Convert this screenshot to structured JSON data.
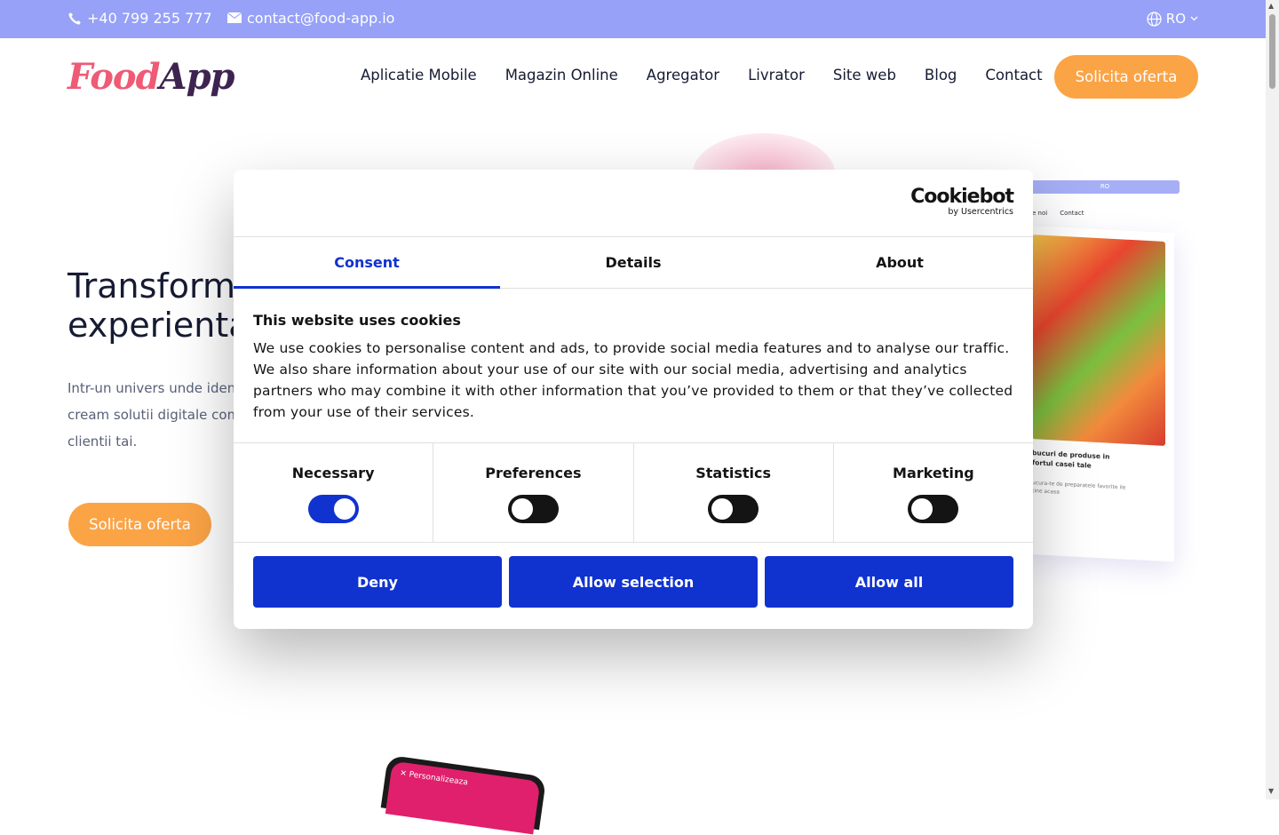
{
  "topbar": {
    "phone": "+40 799 255 777",
    "email": "contact@food-app.io",
    "language": "RO"
  },
  "header": {
    "logo_part1": "Food",
    "logo_part2": "App",
    "nav": [
      "Aplicatie Mobile",
      "Magazin Online",
      "Agregator",
      "Livrator",
      "Site web",
      "Blog",
      "Contact"
    ],
    "cta": "Solicita oferta"
  },
  "hero": {
    "title_line1": "Transforma",
    "title_line2": "experienta",
    "text_line1": "Intr-un univers unde identi",
    "text_line2": "cream solutii digitale comp",
    "text_line3": "clientii tai.",
    "cta": "Solicita oferta"
  },
  "mockup": {
    "lang": "RO",
    "nav_item1": "e noi",
    "nav_item2": "Contact",
    "caption": "bucuri de produse in fortul casei tale",
    "subcaption": "ucura-te de preparatele favorite ile tine acasa"
  },
  "phone": {
    "screen_text": "Personalizeaza"
  },
  "cookie_dialog": {
    "brand_name": "Cookiebot",
    "brand_sub": "by Usercentrics",
    "tabs": [
      "Consent",
      "Details",
      "About"
    ],
    "active_tab": "Consent",
    "title": "This website uses cookies",
    "text": "We use cookies to personalise content and ads, to provide social media features and to analyse our traffic. We also share information about your use of our site with our social media, advertising and analytics partners who may combine it with other information that you’ve provided to them or that they’ve collected from your use of their services.",
    "toggles": [
      {
        "label": "Necessary",
        "on": true
      },
      {
        "label": "Preferences",
        "on": false
      },
      {
        "label": "Statistics",
        "on": false
      },
      {
        "label": "Marketing",
        "on": false
      }
    ],
    "buttons": {
      "deny": "Deny",
      "allow_selection": "Allow selection",
      "allow_all": "Allow all"
    },
    "accent_color": "#1032cf"
  },
  "colors": {
    "topbar": "#96a1f7",
    "cta": "#fba446",
    "text_dark": "#161b33"
  }
}
